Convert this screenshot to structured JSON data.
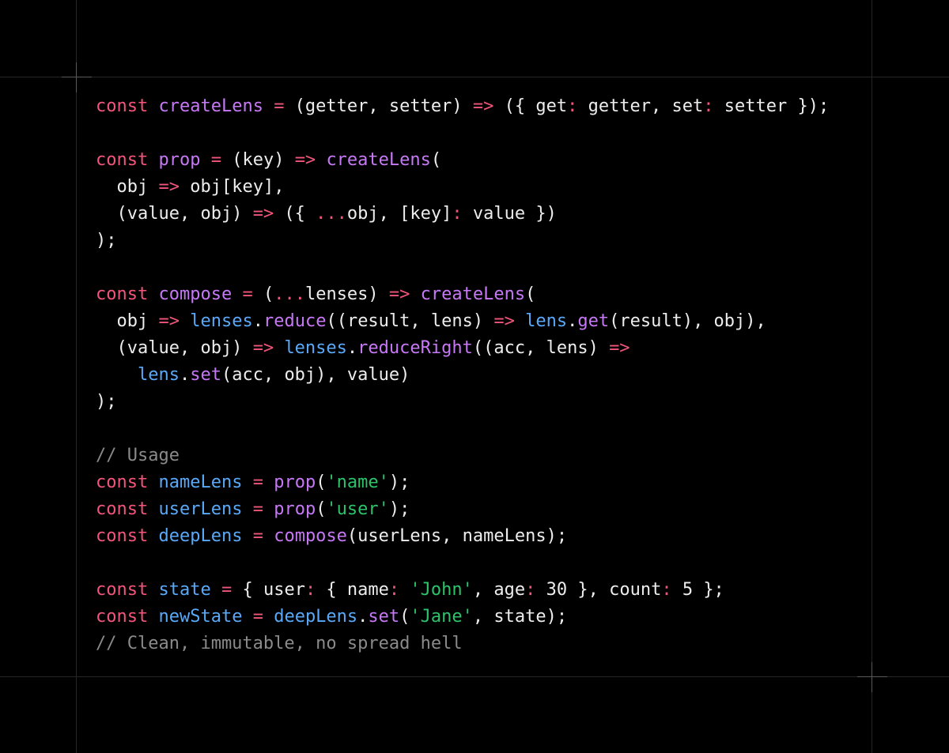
{
  "colors": {
    "background": "#000000",
    "guide": "#262626",
    "crosshair": "#5a5a5a",
    "keyword": "#f1557a",
    "function": "#c678f5",
    "identifier": "#5aa9f8",
    "operator": "#f1557a",
    "string": "#2cc36b",
    "comment": "#8a8a8a",
    "text": "#ededed"
  },
  "code": {
    "language": "javascript",
    "lines": [
      [
        [
          "keyword",
          "const "
        ],
        [
          "function",
          "createLens"
        ],
        [
          "text",
          " "
        ],
        [
          "operator",
          "="
        ],
        [
          "text",
          " (getter, setter) "
        ],
        [
          "operator",
          "=>"
        ],
        [
          "text",
          " ({ get"
        ],
        [
          "operator",
          ":"
        ],
        [
          "text",
          " getter, set"
        ],
        [
          "operator",
          ":"
        ],
        [
          "text",
          " setter });"
        ]
      ],
      [],
      [
        [
          "keyword",
          "const "
        ],
        [
          "function",
          "prop"
        ],
        [
          "text",
          " "
        ],
        [
          "operator",
          "="
        ],
        [
          "text",
          " (key) "
        ],
        [
          "operator",
          "=>"
        ],
        [
          "text",
          " "
        ],
        [
          "function",
          "createLens"
        ],
        [
          "text",
          "("
        ]
      ],
      [
        [
          "text",
          "  obj "
        ],
        [
          "operator",
          "=>"
        ],
        [
          "text",
          " obj[key],"
        ]
      ],
      [
        [
          "text",
          "  (value, obj) "
        ],
        [
          "operator",
          "=>"
        ],
        [
          "text",
          " ({ "
        ],
        [
          "operator",
          "..."
        ],
        [
          "text",
          "obj, [key]"
        ],
        [
          "operator",
          ":"
        ],
        [
          "text",
          " value })"
        ]
      ],
      [
        [
          "text",
          ");"
        ]
      ],
      [],
      [
        [
          "keyword",
          "const "
        ],
        [
          "function",
          "compose"
        ],
        [
          "text",
          " "
        ],
        [
          "operator",
          "="
        ],
        [
          "text",
          " ("
        ],
        [
          "operator",
          "..."
        ],
        [
          "text",
          "lenses) "
        ],
        [
          "operator",
          "=>"
        ],
        [
          "text",
          " "
        ],
        [
          "function",
          "createLens"
        ],
        [
          "text",
          "("
        ]
      ],
      [
        [
          "text",
          "  obj "
        ],
        [
          "operator",
          "=>"
        ],
        [
          "text",
          " "
        ],
        [
          "identifier",
          "lenses"
        ],
        [
          "text",
          "."
        ],
        [
          "function",
          "reduce"
        ],
        [
          "text",
          "((result, lens) "
        ],
        [
          "operator",
          "=>"
        ],
        [
          "text",
          " "
        ],
        [
          "identifier",
          "lens"
        ],
        [
          "text",
          "."
        ],
        [
          "function",
          "get"
        ],
        [
          "text",
          "(result), obj),"
        ]
      ],
      [
        [
          "text",
          "  (value, obj) "
        ],
        [
          "operator",
          "=>"
        ],
        [
          "text",
          " "
        ],
        [
          "identifier",
          "lenses"
        ],
        [
          "text",
          "."
        ],
        [
          "function",
          "reduceRight"
        ],
        [
          "text",
          "((acc, lens) "
        ],
        [
          "operator",
          "=>"
        ]
      ],
      [
        [
          "text",
          "    "
        ],
        [
          "identifier",
          "lens"
        ],
        [
          "text",
          "."
        ],
        [
          "function",
          "set"
        ],
        [
          "text",
          "(acc, obj), value)"
        ]
      ],
      [
        [
          "text",
          ");"
        ]
      ],
      [],
      [
        [
          "comment",
          "// Usage"
        ]
      ],
      [
        [
          "keyword",
          "const "
        ],
        [
          "identifier",
          "nameLens"
        ],
        [
          "text",
          " "
        ],
        [
          "operator",
          "="
        ],
        [
          "text",
          " "
        ],
        [
          "function",
          "prop"
        ],
        [
          "text",
          "("
        ],
        [
          "string",
          "'name'"
        ],
        [
          "text",
          ");"
        ]
      ],
      [
        [
          "keyword",
          "const "
        ],
        [
          "identifier",
          "userLens"
        ],
        [
          "text",
          " "
        ],
        [
          "operator",
          "="
        ],
        [
          "text",
          " "
        ],
        [
          "function",
          "prop"
        ],
        [
          "text",
          "("
        ],
        [
          "string",
          "'user'"
        ],
        [
          "text",
          ");"
        ]
      ],
      [
        [
          "keyword",
          "const "
        ],
        [
          "identifier",
          "deepLens"
        ],
        [
          "text",
          " "
        ],
        [
          "operator",
          "="
        ],
        [
          "text",
          " "
        ],
        [
          "function",
          "compose"
        ],
        [
          "text",
          "(userLens, nameLens);"
        ]
      ],
      [],
      [
        [
          "keyword",
          "const "
        ],
        [
          "identifier",
          "state"
        ],
        [
          "text",
          " "
        ],
        [
          "operator",
          "="
        ],
        [
          "text",
          " { user"
        ],
        [
          "operator",
          ":"
        ],
        [
          "text",
          " { name"
        ],
        [
          "operator",
          ":"
        ],
        [
          "text",
          " "
        ],
        [
          "string",
          "'John'"
        ],
        [
          "text",
          ", age"
        ],
        [
          "operator",
          ":"
        ],
        [
          "text",
          " 30 }, count"
        ],
        [
          "operator",
          ":"
        ],
        [
          "text",
          " 5 };"
        ]
      ],
      [
        [
          "keyword",
          "const "
        ],
        [
          "identifier",
          "newState"
        ],
        [
          "text",
          " "
        ],
        [
          "operator",
          "="
        ],
        [
          "text",
          " "
        ],
        [
          "identifier",
          "deepLens"
        ],
        [
          "text",
          "."
        ],
        [
          "function",
          "set"
        ],
        [
          "text",
          "("
        ],
        [
          "string",
          "'Jane'"
        ],
        [
          "text",
          ", state);"
        ]
      ],
      [
        [
          "comment",
          "// Clean, immutable, no spread hell"
        ]
      ]
    ]
  }
}
